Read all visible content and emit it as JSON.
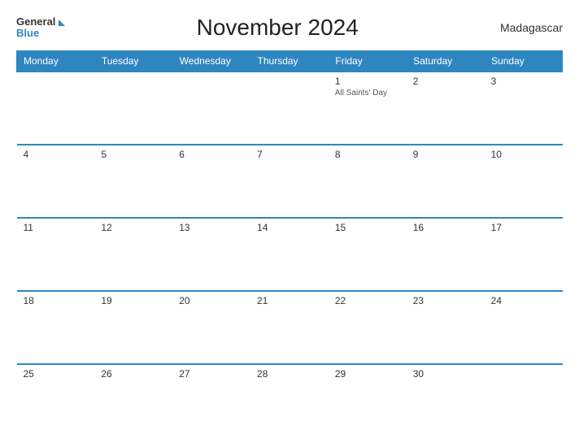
{
  "header": {
    "logo_general": "General",
    "logo_blue": "Blue",
    "title": "November 2024",
    "country": "Madagascar"
  },
  "days_of_week": [
    "Monday",
    "Tuesday",
    "Wednesday",
    "Thursday",
    "Friday",
    "Saturday",
    "Sunday"
  ],
  "weeks": [
    [
      {
        "day": "",
        "holiday": ""
      },
      {
        "day": "",
        "holiday": ""
      },
      {
        "day": "",
        "holiday": ""
      },
      {
        "day": "",
        "holiday": ""
      },
      {
        "day": "1",
        "holiday": "All Saints' Day"
      },
      {
        "day": "2",
        "holiday": ""
      },
      {
        "day": "3",
        "holiday": ""
      }
    ],
    [
      {
        "day": "4",
        "holiday": ""
      },
      {
        "day": "5",
        "holiday": ""
      },
      {
        "day": "6",
        "holiday": ""
      },
      {
        "day": "7",
        "holiday": ""
      },
      {
        "day": "8",
        "holiday": ""
      },
      {
        "day": "9",
        "holiday": ""
      },
      {
        "day": "10",
        "holiday": ""
      }
    ],
    [
      {
        "day": "11",
        "holiday": ""
      },
      {
        "day": "12",
        "holiday": ""
      },
      {
        "day": "13",
        "holiday": ""
      },
      {
        "day": "14",
        "holiday": ""
      },
      {
        "day": "15",
        "holiday": ""
      },
      {
        "day": "16",
        "holiday": ""
      },
      {
        "day": "17",
        "holiday": ""
      }
    ],
    [
      {
        "day": "18",
        "holiday": ""
      },
      {
        "day": "19",
        "holiday": ""
      },
      {
        "day": "20",
        "holiday": ""
      },
      {
        "day": "21",
        "holiday": ""
      },
      {
        "day": "22",
        "holiday": ""
      },
      {
        "day": "23",
        "holiday": ""
      },
      {
        "day": "24",
        "holiday": ""
      }
    ],
    [
      {
        "day": "25",
        "holiday": ""
      },
      {
        "day": "26",
        "holiday": ""
      },
      {
        "day": "27",
        "holiday": ""
      },
      {
        "day": "28",
        "holiday": ""
      },
      {
        "day": "29",
        "holiday": ""
      },
      {
        "day": "30",
        "holiday": ""
      },
      {
        "day": "",
        "holiday": ""
      }
    ]
  ]
}
